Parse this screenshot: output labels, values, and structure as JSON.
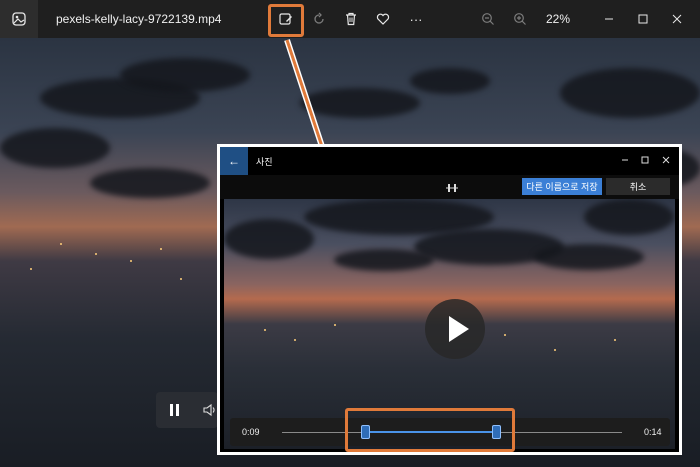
{
  "titlebar": {
    "file_name": "pexels-kelly-lacy-9722139.mp4",
    "zoom_level": "22%",
    "more_label": "···",
    "buttons": [
      "edit-video-icon",
      "rotate-icon",
      "delete-icon",
      "favorite-icon",
      "more-icon",
      "zoom-out-icon",
      "zoom-in-icon"
    ],
    "window_controls": [
      "minimize",
      "maximize",
      "close"
    ]
  },
  "player": {
    "pause_icon": "pause-icon",
    "volume_icon": "volume-icon"
  },
  "dialog": {
    "title": "사진",
    "back_label": "←",
    "save_as_label": "다른 이름으로 저장",
    "cancel_label": "취소",
    "time_start": "0:09",
    "time_end": "0:14",
    "trim_start_fraction": 0.25,
    "trim_end_fraction": 0.64
  },
  "colors": {
    "accent": "#3b7fd6",
    "highlight": "#e07a3a",
    "titlebar_bg": "#1f1f1f"
  }
}
